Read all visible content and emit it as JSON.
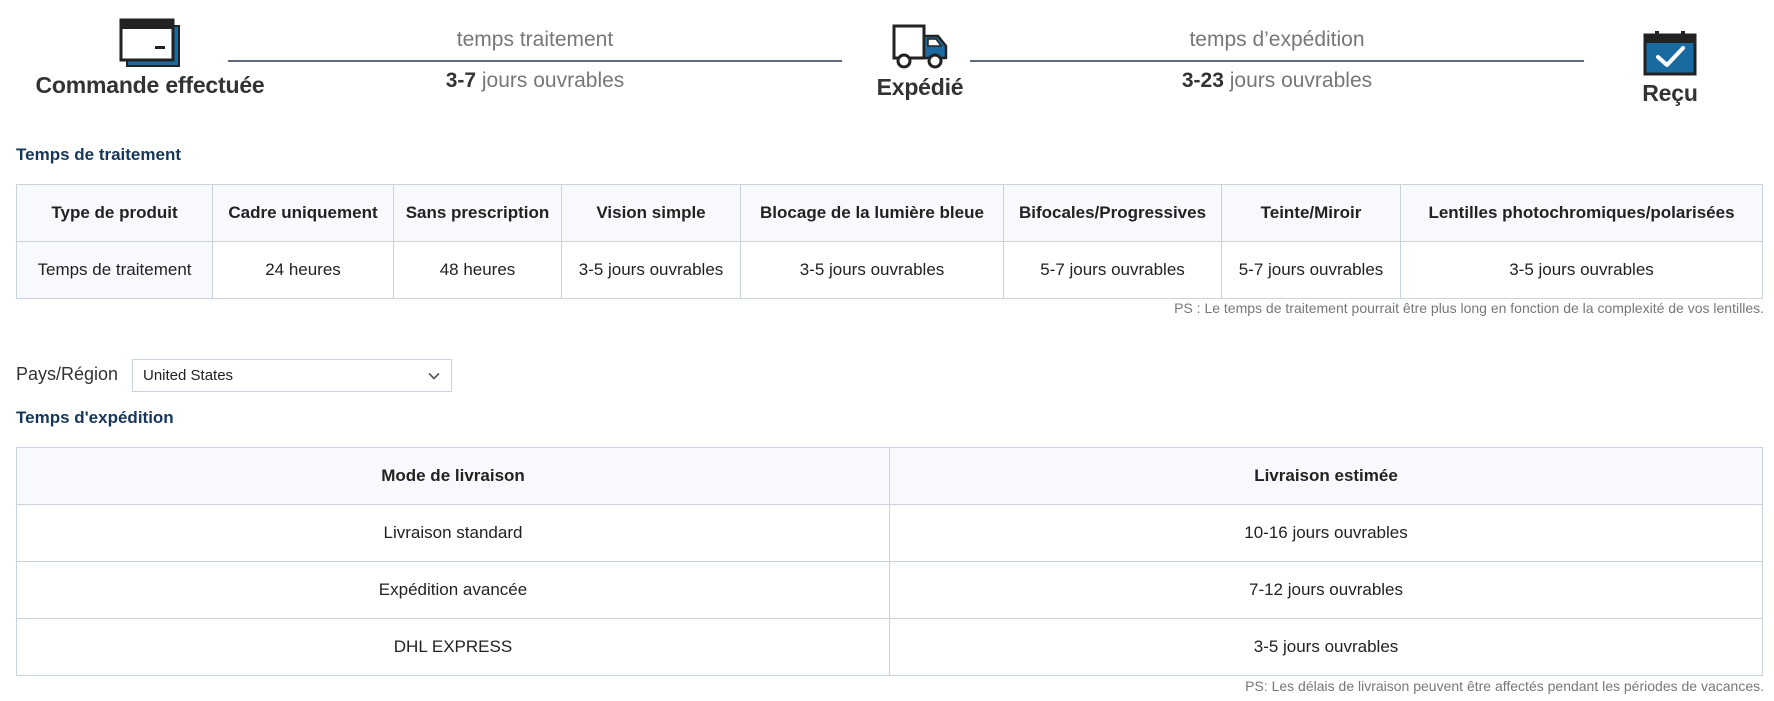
{
  "timeline": {
    "stages": [
      {
        "label": "Commande effectuée",
        "icon": "credit-card-icon"
      },
      {
        "label": "Expédié",
        "icon": "truck-icon"
      },
      {
        "label": "Reçu",
        "icon": "calendar-check-icon"
      }
    ],
    "segments": [
      {
        "title": "temps traitement",
        "range": "3-7",
        "unit": " jours ouvrables"
      },
      {
        "title": "temps d’expédition",
        "range": "3-23",
        "unit": " jours ouvrables"
      }
    ],
    "colors": {
      "icon_blue": "#1a6aa2",
      "icon_dark": "#222222"
    }
  },
  "processing": {
    "title": "Temps de traitement",
    "headers": [
      "Type de produit",
      "Cadre uniquement",
      "Sans prescription",
      "Vision simple",
      "Blocage de la lumière bleue",
      "Bifocales/Progressives",
      "Teinte/Miroir",
      "Lentilles photochromiques/polarisées"
    ],
    "row": [
      "Temps de traitement",
      "24 heures",
      "48 heures",
      "3-5 jours ouvrables",
      "3-5 jours ouvrables",
      "5-7 jours ouvrables",
      "5-7 jours ouvrables",
      "3-5 jours ouvrables"
    ],
    "note": "PS : Le temps de traitement pourrait être plus long en fonction de la complexité de vos lentilles."
  },
  "country": {
    "label": "Pays/Région",
    "selected": "United States"
  },
  "shipping": {
    "title": "Temps d'expédition",
    "headers": [
      "Mode de livraison",
      "Livraison estimée"
    ],
    "rows": [
      [
        "Livraison standard",
        "10-16 jours ouvrables"
      ],
      [
        "Expédition avancée",
        "7-12 jours ouvrables"
      ],
      [
        "DHL EXPRESS",
        "3-5 jours ouvrables"
      ]
    ],
    "note": "PS: Les délais de livraison peuvent être affectés pendant les périodes de vacances."
  }
}
